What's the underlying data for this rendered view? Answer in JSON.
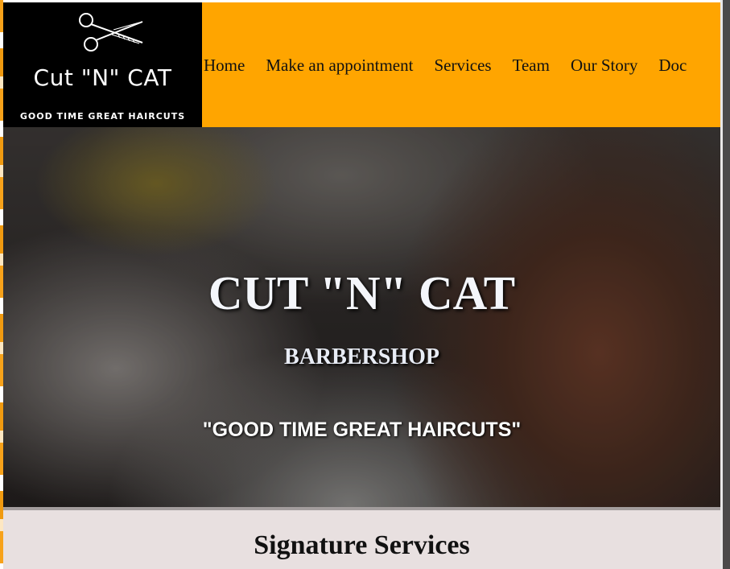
{
  "brand": {
    "logo_icon": "scissors-icon",
    "name": "Cut \"N\" CAT",
    "tagline": "GOOD TIME GREAT HAIRCUTS"
  },
  "nav": {
    "items": [
      {
        "label": "Home"
      },
      {
        "label": "Make an appointment"
      },
      {
        "label": "Services"
      },
      {
        "label": "Team"
      },
      {
        "label": "Our Story"
      },
      {
        "label": "Doc"
      }
    ]
  },
  "hero": {
    "title": "CUT \"N\" CAT",
    "subtitle": "BARBERSHOP",
    "tagline": "\"GOOD TIME GREAT HAIRCUTS\""
  },
  "services": {
    "heading": "Signature Services"
  },
  "colors": {
    "header_bg": "#ffa500",
    "logo_bg": "#000000",
    "section_bg": "#e8e0e0"
  }
}
